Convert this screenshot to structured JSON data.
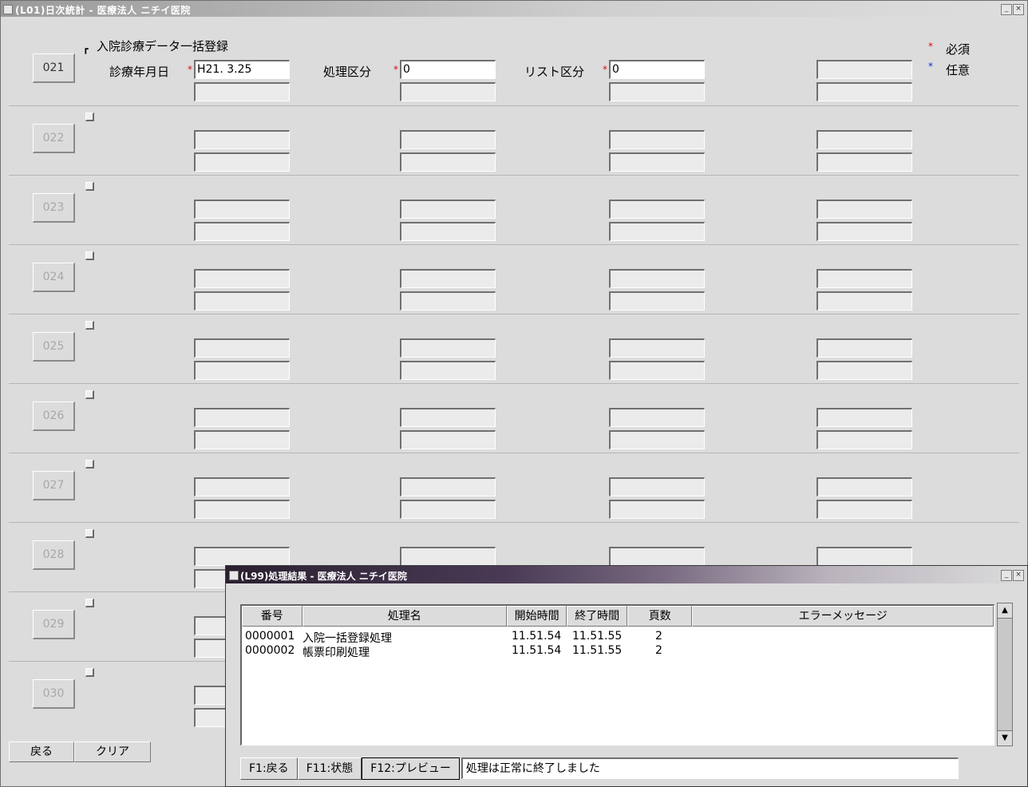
{
  "window": {
    "title": "(L01)日次統計 - 医療法人 ニチイ医院"
  },
  "legend": {
    "required": "必須",
    "optional": "任意",
    "required_mark": "*",
    "optional_mark": "*"
  },
  "rows": [
    {
      "number": "021",
      "checkbox_label": "入院診療データ一括登録",
      "checked": true,
      "fields": {
        "date_label": "診療年月日",
        "date_value": "H21. 3.25",
        "proc_label": "処理区分",
        "proc_value": "0",
        "list_label": "リスト区分",
        "list_value": "0"
      }
    },
    {
      "number": "022"
    },
    {
      "number": "023"
    },
    {
      "number": "024"
    },
    {
      "number": "025"
    },
    {
      "number": "026"
    },
    {
      "number": "027"
    },
    {
      "number": "028"
    },
    {
      "number": "029"
    },
    {
      "number": "030"
    }
  ],
  "bottom_buttons": [
    "戻る",
    "クリア"
  ],
  "popup": {
    "title": "(L99)処理結果 - 医療法人 ニチイ医院",
    "columns": [
      "番号",
      "処理名",
      "開始時間",
      "終了時間",
      "頁数",
      "エラーメッセージ"
    ],
    "rows": [
      {
        "no": "0000001",
        "name": "入院一括登録処理",
        "start": "11.51.54",
        "end": "11.51.55",
        "pages": "2",
        "error": ""
      },
      {
        "no": "0000002",
        "name": "帳票印刷処理",
        "start": "11.51.54",
        "end": "11.51.55",
        "pages": "2",
        "error": ""
      }
    ],
    "buttons": [
      "F1:戻る",
      "F11:状態",
      "F12:プレビュー"
    ],
    "status": "処理は正常に終了しました"
  },
  "colors": {
    "required": "#d01010",
    "optional": "#1030d0"
  }
}
